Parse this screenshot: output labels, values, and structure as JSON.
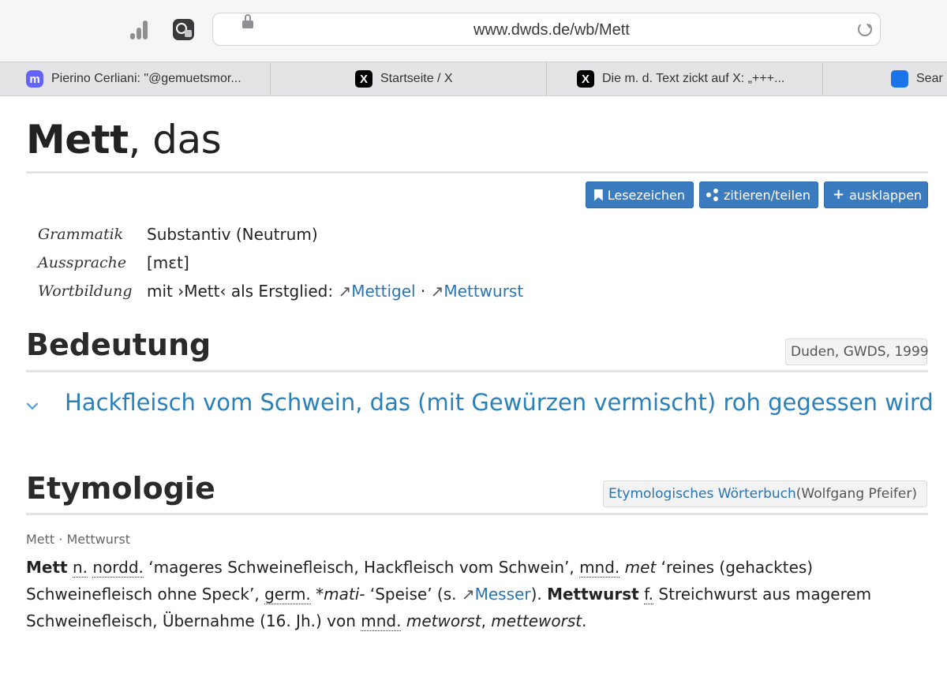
{
  "browser": {
    "url": "www.dwds.de/wb/Mett",
    "tabs": [
      {
        "label": "Pierino Cerliani: \"@gemuetsmor...",
        "icon": "mastodon-icon"
      },
      {
        "label": "Startseite / X",
        "icon": "x-icon"
      },
      {
        "label": "Die m. d. Text zickt auf X: „+++...",
        "icon": "x-icon"
      },
      {
        "label": "Sear",
        "icon": "search-icon"
      }
    ]
  },
  "entry": {
    "lemma": "Mett",
    "article": ", das"
  },
  "actions": {
    "bookmark": "Lesezeichen",
    "cite": "zitieren/teilen",
    "expand": "ausklappen"
  },
  "grammar": {
    "grammatik_label": "Grammatik",
    "grammatik_value": "Substantiv (Neutrum)",
    "aussprache_label": "Aussprache",
    "aussprache_value": "[mɛt]",
    "wortbildung_label": "Wortbildung",
    "wortbildung_prefix": "mit ›Mett‹ als Erstglied:",
    "wortbildung_links": [
      "Mettigel",
      "Mettwurst"
    ]
  },
  "bedeutung": {
    "heading": "Bedeutung",
    "source": "Duden, GWDS, 1999",
    "meaning": "Hackfleisch vom Schwein, das (mit Gewürzen vermischt) roh gegessen wird"
  },
  "etymologie": {
    "heading": "Etymologie",
    "source_link": "Etymologisches Wörterbuch",
    "source_author": " (Wolfgang Pfeifer)",
    "sub": "Mett · Mettwurst",
    "text": {
      "w1": "Mett",
      "a1": "n.",
      "a2": "nordd.",
      "t1": " ‘mageres Schweinefleisch, Hackfleisch vom Schwein’, ",
      "a3": "mnd.",
      "i1": "met",
      "t2": " ‘reines (gehacktes) Schweinefleisch ohne Speck’, ",
      "a4": "germ.",
      "i2": "*mati-",
      "t3": " ‘Speise’ (s. ",
      "l1": "Messer",
      "t4": "). ",
      "w2": "Mettwurst",
      "a5": "f.",
      "t5": " Streichwurst aus magerem Schweinefleisch, Übernahme (16. Jh.) von ",
      "a6": "mnd.",
      "i3": "metworst",
      "t6": ", ",
      "i4": "metteworst",
      "t7": "."
    }
  }
}
